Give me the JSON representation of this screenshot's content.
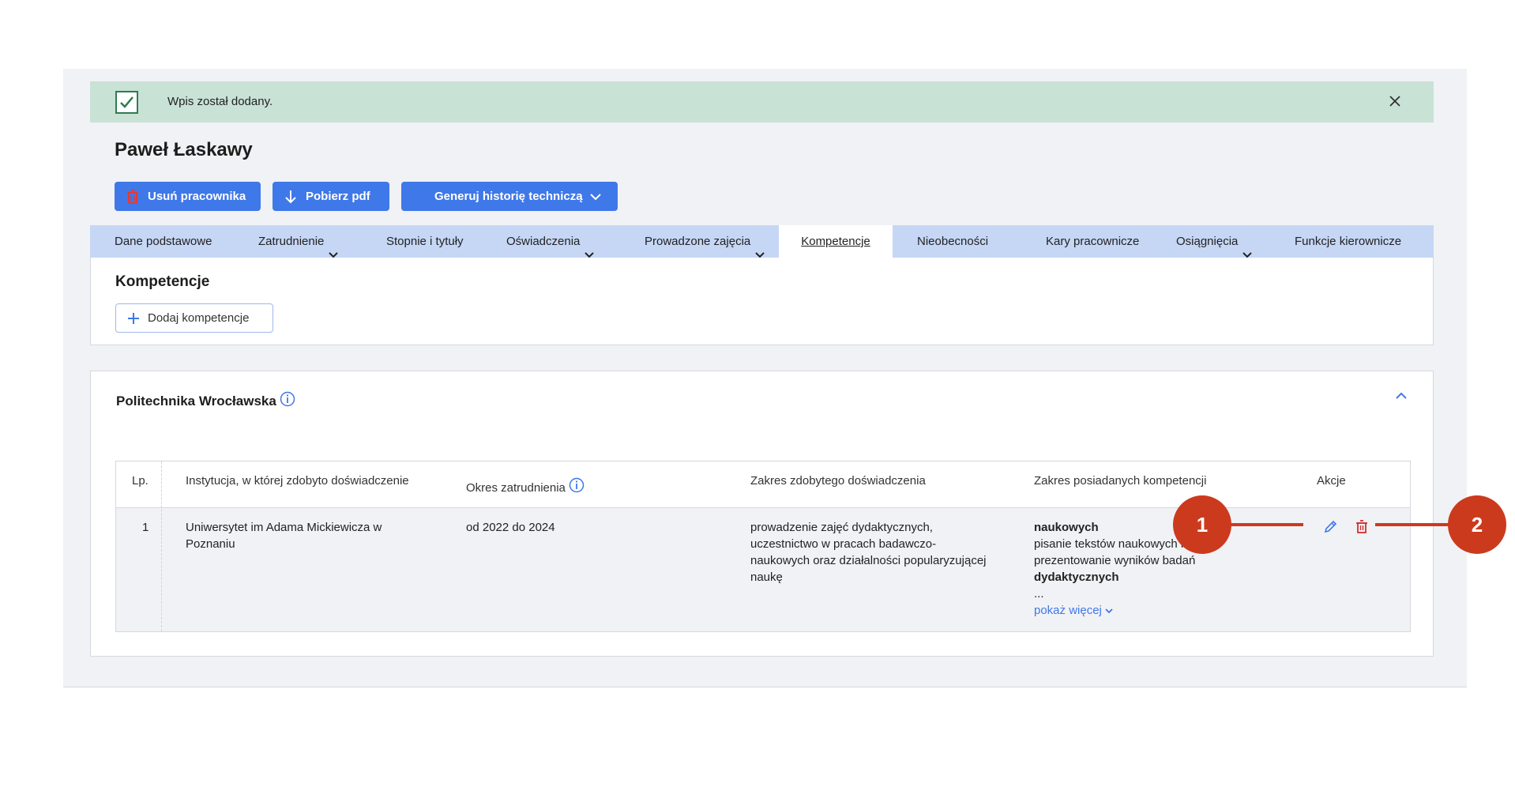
{
  "alert": {
    "message": "Wpis został dodany."
  },
  "employee": {
    "name": "Paweł Łaskawy"
  },
  "actions": {
    "delete_label": "Usuń pracownika",
    "pdf_label": "Pobierz pdf",
    "generate_label": "Generuj historię techniczą"
  },
  "tabs": [
    {
      "label": "Dane podstawowe",
      "has_dropdown": false
    },
    {
      "label": "Zatrudnienie",
      "has_dropdown": true
    },
    {
      "label": "Stopnie i tytuły",
      "has_dropdown": false
    },
    {
      "label": "Oświadczenia",
      "has_dropdown": true
    },
    {
      "label": "Prowadzone zajęcia",
      "has_dropdown": true
    },
    {
      "label": "Kompetencje",
      "has_dropdown": false,
      "active": true
    },
    {
      "label": "Nieobecności",
      "has_dropdown": false
    },
    {
      "label": "Kary pracownicze",
      "has_dropdown": false
    },
    {
      "label": "Osiągnięcia",
      "has_dropdown": true
    },
    {
      "label": "Funkcje kierownicze",
      "has_dropdown": false
    }
  ],
  "section": {
    "title": "Kompetencje",
    "add_label": "Dodaj kompetencje"
  },
  "institution": {
    "name": "Politechnika Wrocławska"
  },
  "table": {
    "headers": {
      "lp": "Lp.",
      "institution": "Instytucja, w której zdobyto doświadczenie",
      "period": "Okres zatrudnienia",
      "experience": "Zakres zdobytego doświadczenia",
      "competences": "Zakres posiadanych kompetencji",
      "actions": "Akcje"
    },
    "rows": [
      {
        "lp": "1",
        "institution_line1": "Uniwersytet im Adama Mickiewicza w",
        "institution_line2": "Poznaniu",
        "period": "od 2022 do 2024",
        "experience_lines": [
          "prowadzenie zajęć dydaktycznych,",
          "uczestnictwo w pracach badawczo-",
          "naukowych oraz działalności popularyzującej",
          "naukę"
        ],
        "comp_heading1": "naukowych",
        "comp_line1": "pisanie tekstów naukowych i",
        "comp_line2": "prezentowanie wyników badań",
        "comp_heading2": "dydaktycznych",
        "comp_ellipsis": "...",
        "show_more": "pokaż więcej"
      }
    ]
  },
  "callouts": {
    "one": "1",
    "two": "2"
  },
  "colors": {
    "primary": "#3f78e8",
    "alert_bg": "#c8e2d6",
    "tabs_bg": "#c6d6f5",
    "danger": "#d32f2f",
    "callout": "#cc3a1e"
  },
  "icons": [
    "check-icon",
    "close-icon",
    "trash-icon",
    "download-icon",
    "chevron-down-icon",
    "plus-icon",
    "info-icon",
    "chevron-up-icon",
    "pencil-icon"
  ]
}
